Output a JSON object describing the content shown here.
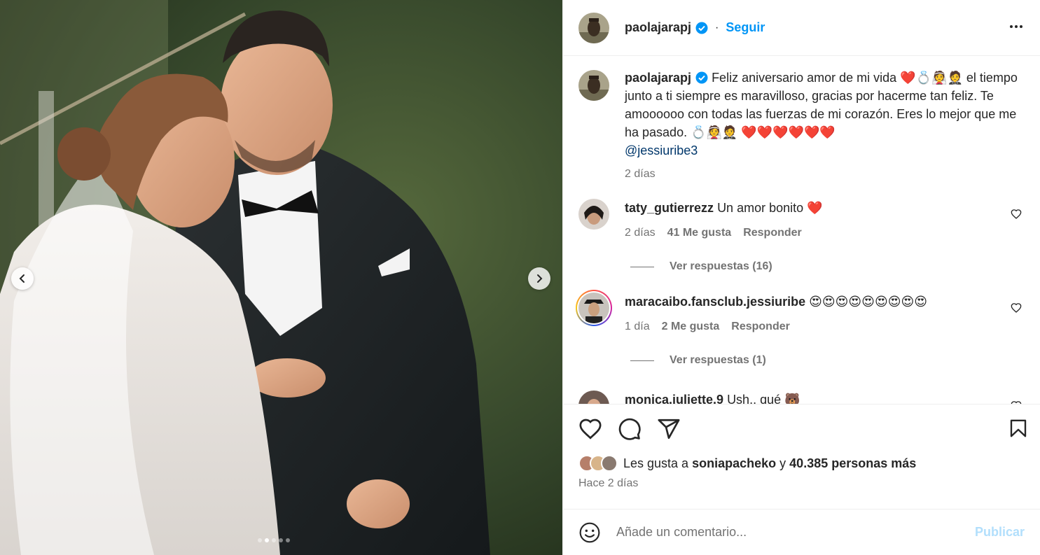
{
  "post": {
    "author": "paolajarapj",
    "follow_label": "Seguir",
    "separator": "·"
  },
  "caption": {
    "user": "paolajarapj",
    "text_1": "Feliz aniversario amor de mi vida ",
    "text_2": " el tiempo junto a ti siempre es maravilloso, gracias por hacerme tan feliz. Te amoooooo con todas las fuerzas de mi corazón. Eres lo mejor que me ha pasado. ",
    "mention": "@jessiuribe3",
    "time": "2 días"
  },
  "comments": [
    {
      "user": "taty_gutierrezz",
      "text": "Un amor bonito",
      "time": "2 días",
      "likes": "41 Me gusta",
      "reply": "Responder",
      "view_replies": "Ver respuestas (16)"
    },
    {
      "user": "maracaibo.fansclub.jessiuribe",
      "text": "",
      "time": "1 día",
      "likes": "2 Me gusta",
      "reply": "Responder",
      "view_replies": "Ver respuestas (1)"
    },
    {
      "user": "monica.juliette.9",
      "text": "Ush.. qué"
    }
  ],
  "likes": {
    "prefix": "Les gusta a ",
    "user": "soniapacheko",
    "mid": " y ",
    "count": "40.385 personas más"
  },
  "posted": "Hace 2 días",
  "composer": {
    "placeholder": "Añade un comentario...",
    "publish": "Publicar"
  },
  "carousel": {
    "slides": 5,
    "current": 2
  },
  "colors": {
    "accent": "#0095f6",
    "heart": "#ff3040",
    "muted": "#737373"
  }
}
